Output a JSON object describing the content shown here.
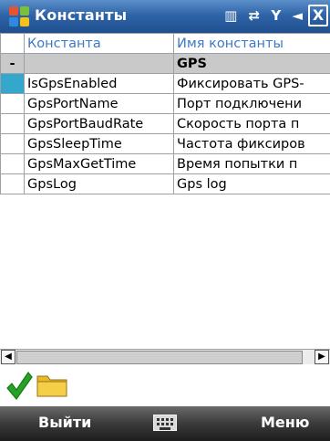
{
  "window": {
    "title": "Константы",
    "close_label": "X",
    "status_icons": [
      "keyboard-status-icon",
      "sync-icon",
      "signal-icon",
      "speaker-icon"
    ]
  },
  "grid": {
    "columns": [
      "Константа",
      "Имя константы"
    ],
    "group": {
      "toggle": "-",
      "name": "GPS"
    },
    "rows": [
      {
        "constant": "IsGpsEnabled",
        "name": "Фиксировать GPS-"
      },
      {
        "constant": "GpsPortName",
        "name": "Порт подключени"
      },
      {
        "constant": "GpsPortBaudRate",
        "name": "Скорость порта п"
      },
      {
        "constant": "GpsSleepTime",
        "name": "Частота фиксиров"
      },
      {
        "constant": "GpsMaxGetTime",
        "name": "Время попытки п"
      },
      {
        "constant": "GpsLog",
        "name": "Gps log"
      }
    ]
  },
  "toolbar": {
    "icons": [
      "check-icon",
      "folder-icon"
    ]
  },
  "softkeys": {
    "left": "Выйти",
    "right": "Меню"
  },
  "colors": {
    "titlebar": "#2f64a9",
    "header_text": "#3d78c4",
    "group_row": "#c9c9c9",
    "selected_cell": "#34a7cc",
    "softbar": "#3a3a3a"
  }
}
